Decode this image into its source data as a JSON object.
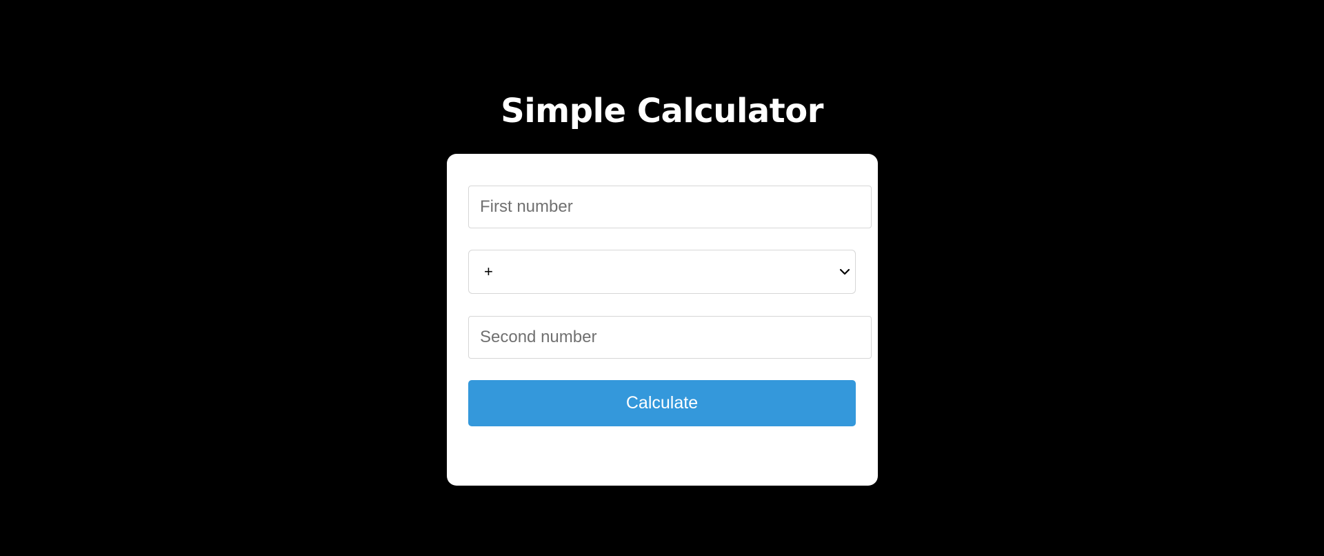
{
  "title": "Simple Calculator",
  "form": {
    "first_number": {
      "placeholder": "First number",
      "value": ""
    },
    "operator": {
      "selected": "+",
      "icon": "chevron-down-icon"
    },
    "second_number": {
      "placeholder": "Second number",
      "value": ""
    },
    "calculate_label": "Calculate"
  },
  "colors": {
    "background": "#000000",
    "card": "#ffffff",
    "button": "#3498db",
    "button_text": "#ffffff"
  }
}
